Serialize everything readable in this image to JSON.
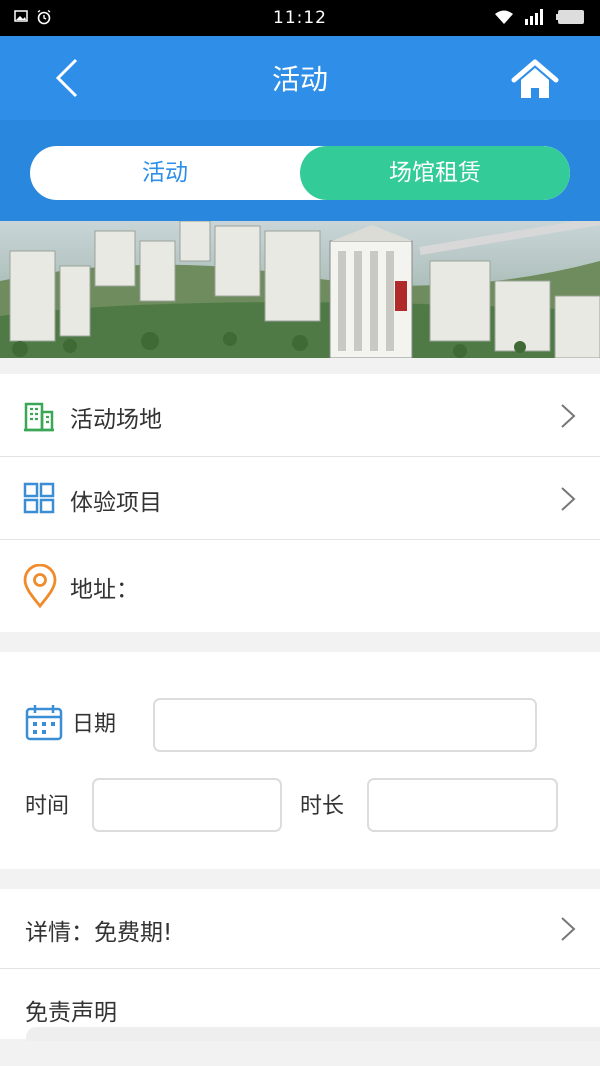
{
  "status_bar": {
    "time": "11:12",
    "left_icons": [
      "image-icon",
      "alarm-icon"
    ],
    "right_icons": [
      "wifi-icon",
      "signal-icon",
      "battery-icon"
    ]
  },
  "header": {
    "title": "活动",
    "back_icon": "chevron-left-icon",
    "home_icon": "home-icon",
    "background": "#2f8fe8"
  },
  "tabs": [
    {
      "label": "活动",
      "selected": false
    },
    {
      "label": "场馆租赁",
      "selected": true
    }
  ],
  "accent": {
    "tab_selected": "#33cc99",
    "tab_text": "#2f8fe8"
  },
  "banner": {
    "icon": "city-banner-image"
  },
  "menu": [
    {
      "label": "活动场地",
      "icon": "building-icon",
      "icon_color": "#3aa757",
      "chevron": true
    },
    {
      "label": "体验项目",
      "icon": "grid-icon",
      "icon_color": "#3a8ed6",
      "chevron": true
    },
    {
      "label": "地址：",
      "icon": "location-pin-icon",
      "icon_color": "#f08a2a",
      "chevron": false
    }
  ],
  "form": {
    "date_label": "日期",
    "date_value": "",
    "time_label": "时间",
    "time_value": "",
    "duration_label": "时长",
    "duration_value": "",
    "calendar_icon": "calendar-icon"
  },
  "details": {
    "label": "详情：免费期!",
    "chevron": true
  },
  "disclaimer": {
    "label": "免责声明"
  }
}
